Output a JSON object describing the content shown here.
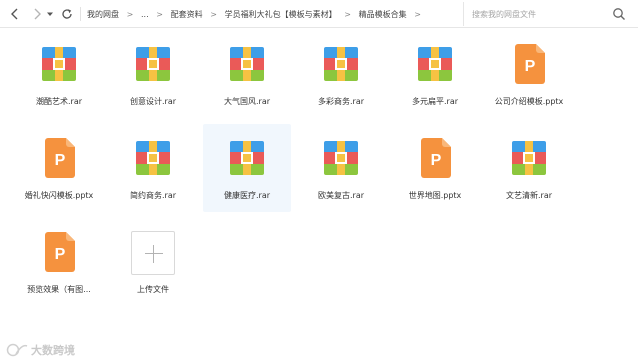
{
  "toolbar": {
    "back_icon": "chevron-left-icon",
    "forward_icon": "chevron-right-icon",
    "history_icon": "caret-down-icon",
    "refresh_icon": "refresh-icon"
  },
  "breadcrumb": {
    "items": [
      "我的网盘",
      "...",
      "配套资料",
      "学员福利大礼包【模板与素材】",
      "精品模板合集"
    ],
    "separator": ">"
  },
  "search": {
    "placeholder": "搜索我的网盘文件"
  },
  "files": [
    {
      "name": "潮酷艺术.rar",
      "type": "rar"
    },
    {
      "name": "创意设计.rar",
      "type": "rar"
    },
    {
      "name": "大气国风.rar",
      "type": "rar"
    },
    {
      "name": "多彩商务.rar",
      "type": "rar"
    },
    {
      "name": "多元扁平.rar",
      "type": "rar"
    },
    {
      "name": "公司介绍模板.pptx",
      "type": "pptx"
    },
    {
      "name": "婚礼快闪模板.pptx",
      "type": "pptx"
    },
    {
      "name": "简约商务.rar",
      "type": "rar"
    },
    {
      "name": "健康医疗.rar",
      "type": "rar",
      "selected": true
    },
    {
      "name": "欧美复古.rar",
      "type": "rar"
    },
    {
      "name": "世界地图.pptx",
      "type": "pptx"
    },
    {
      "name": "文艺清新.rar",
      "type": "rar"
    },
    {
      "name": "预览效果（有图...",
      "type": "pptx"
    }
  ],
  "upload": {
    "label": "上传文件"
  },
  "watermark": {
    "text": "大数跨境"
  },
  "colors": {
    "rar_blue": "#3e9ee8",
    "rar_red": "#ea5a58",
    "rar_green": "#8cc63e",
    "rar_strap": "#f6c243",
    "ppt_orange": "#f5923e",
    "selected_bg": "#f1f7fd"
  }
}
